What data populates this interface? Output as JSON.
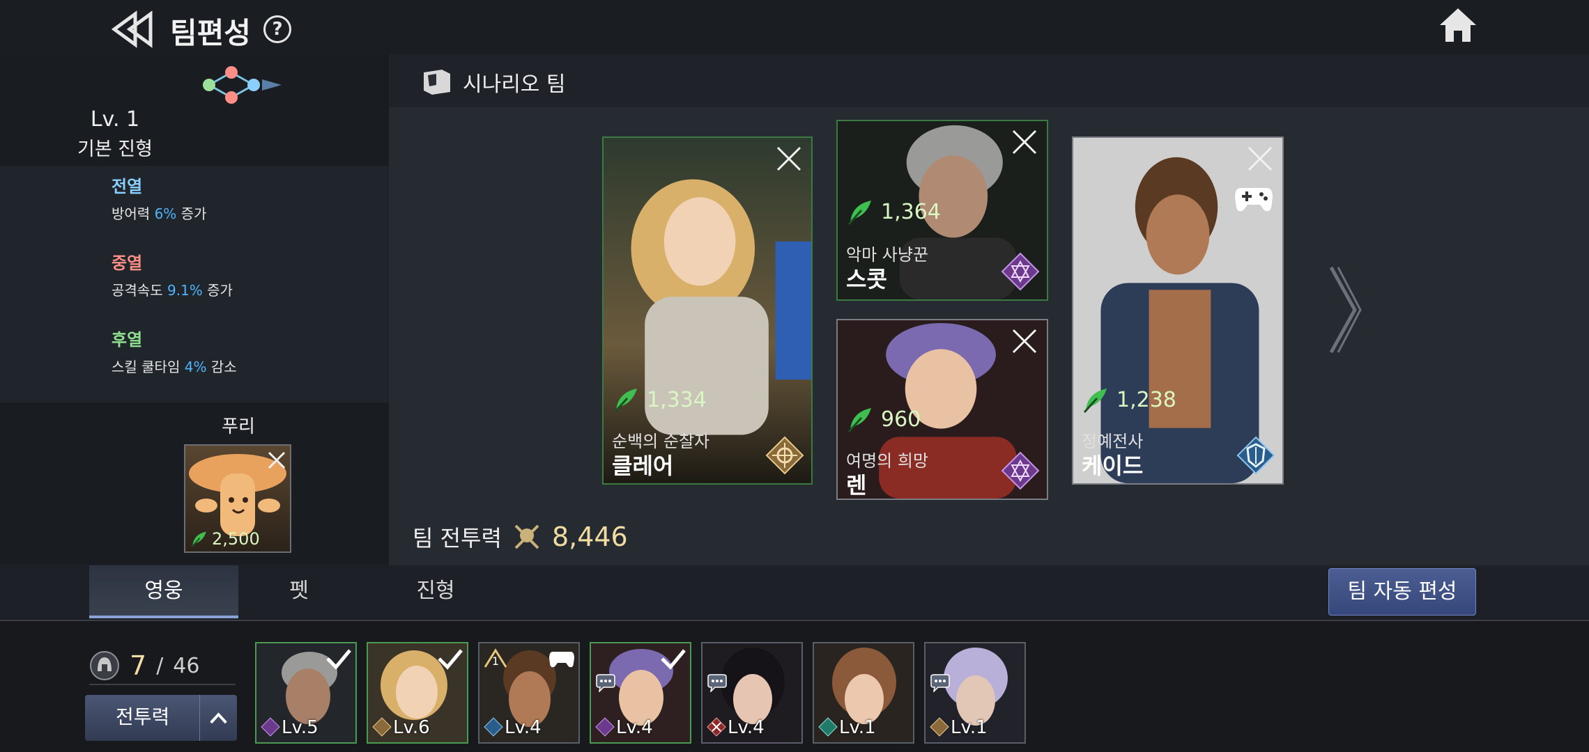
{
  "header": {
    "title": "팀편성",
    "help": "?"
  },
  "formation": {
    "level": "Lv. 1",
    "name": "기본 진형",
    "rows": [
      {
        "title": "전열",
        "color": "#8ad0ff",
        "prefix": "방어력 ",
        "pct": "6%",
        "suffix": " 증가"
      },
      {
        "title": "중열",
        "color": "#ff8f86",
        "prefix": "공격속도 ",
        "pct": "9.1%",
        "suffix": " 증가"
      },
      {
        "title": "후열",
        "color": "#8fe08f",
        "prefix": "스킬 쿨타임 ",
        "pct": "4%",
        "suffix": " 감소"
      }
    ],
    "pet_label": "푸리",
    "pet_power": "2,500"
  },
  "team": {
    "title": "시나리오 팀",
    "heroes": [
      {
        "power": "1,334",
        "sub": "순백의 순찰자",
        "name": "클레어"
      },
      {
        "power": "1,364",
        "sub": "악마 사냥꾼",
        "name": "스콧"
      },
      {
        "power": "960",
        "sub": "여명의 희망",
        "name": "렌"
      },
      {
        "power": "1,238",
        "sub": "정예전사",
        "name": "케이드"
      }
    ],
    "total_power_label": "팀 전투력",
    "total_power": "8,446"
  },
  "tabs": [
    "영웅",
    "펫",
    "진형"
  ],
  "auto_button": "팀 자동 편성",
  "roster": {
    "count": "7",
    "total": "46",
    "sort_label": "전투력",
    "cards": [
      {
        "lv": "Lv.5",
        "selected": true
      },
      {
        "lv": "Lv.6",
        "selected": true
      },
      {
        "lv": "Lv.4",
        "rank": "1"
      },
      {
        "lv": "Lv.4",
        "selected": true
      },
      {
        "lv": "Lv.4"
      },
      {
        "lv": "Lv.1"
      },
      {
        "lv": "Lv.1"
      }
    ]
  },
  "colors": {
    "accent_power": "#d9f7c2",
    "total_power": "#f1dca1",
    "percent": "#4fb5ff"
  }
}
